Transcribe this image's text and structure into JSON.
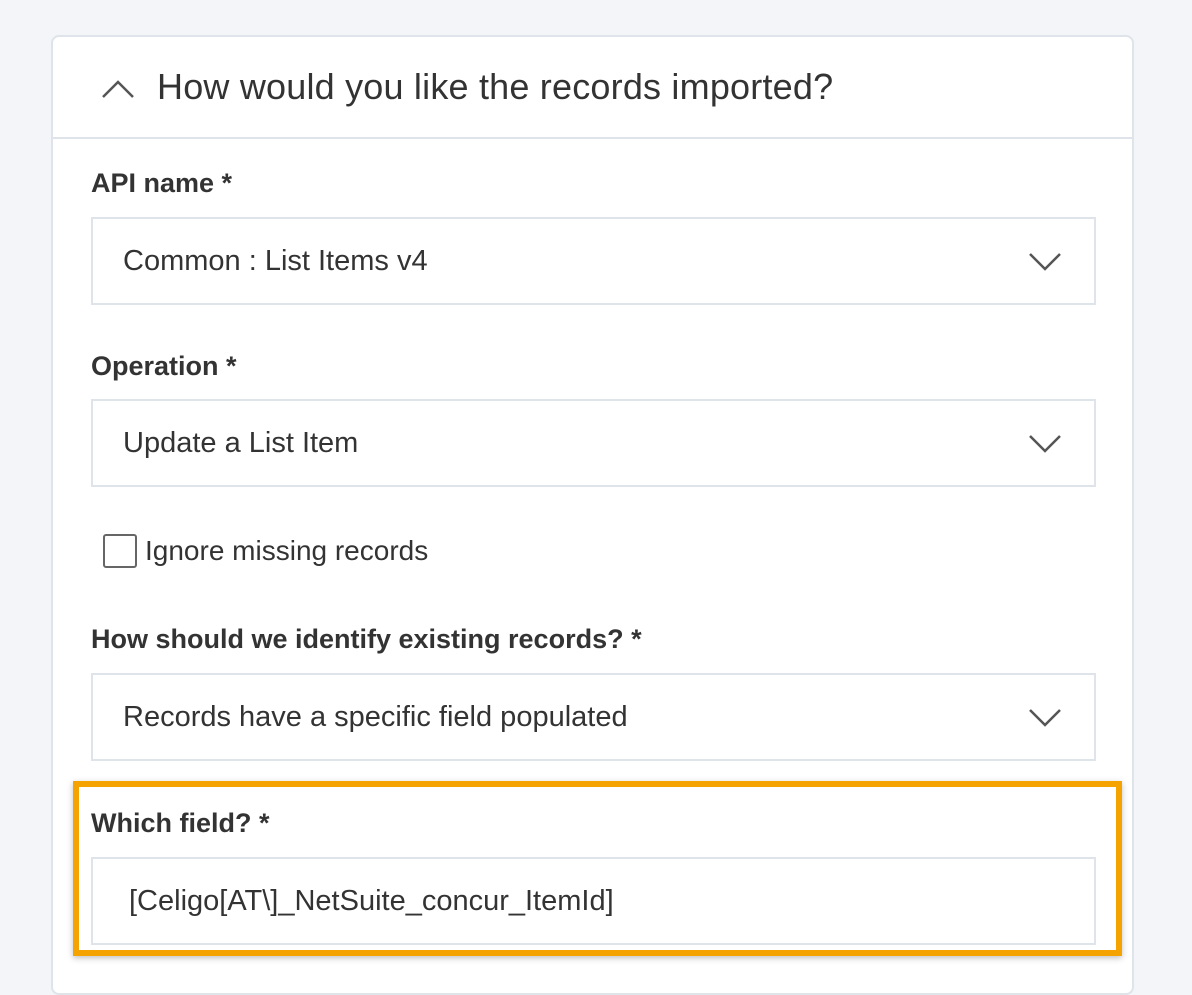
{
  "section": {
    "title": "How would you like the records imported?",
    "toggle_icon": "chevron-up-icon"
  },
  "api_name": {
    "label": "API name *",
    "value": "Common : List Items v4"
  },
  "operation": {
    "label": "Operation *",
    "value": "Update a List Item"
  },
  "ignore_missing": {
    "label": "Ignore missing records",
    "checked": false
  },
  "identify_records": {
    "label": "How should we identify existing records? *",
    "value": "Records have a specific field populated"
  },
  "which_field": {
    "label": "Which field? *",
    "value": "[Celigo[AT\\]_NetSuite_concur_ItemId]"
  },
  "colors": {
    "highlight": "#f5a300",
    "border": "#dfe4ea",
    "text": "#333333"
  }
}
